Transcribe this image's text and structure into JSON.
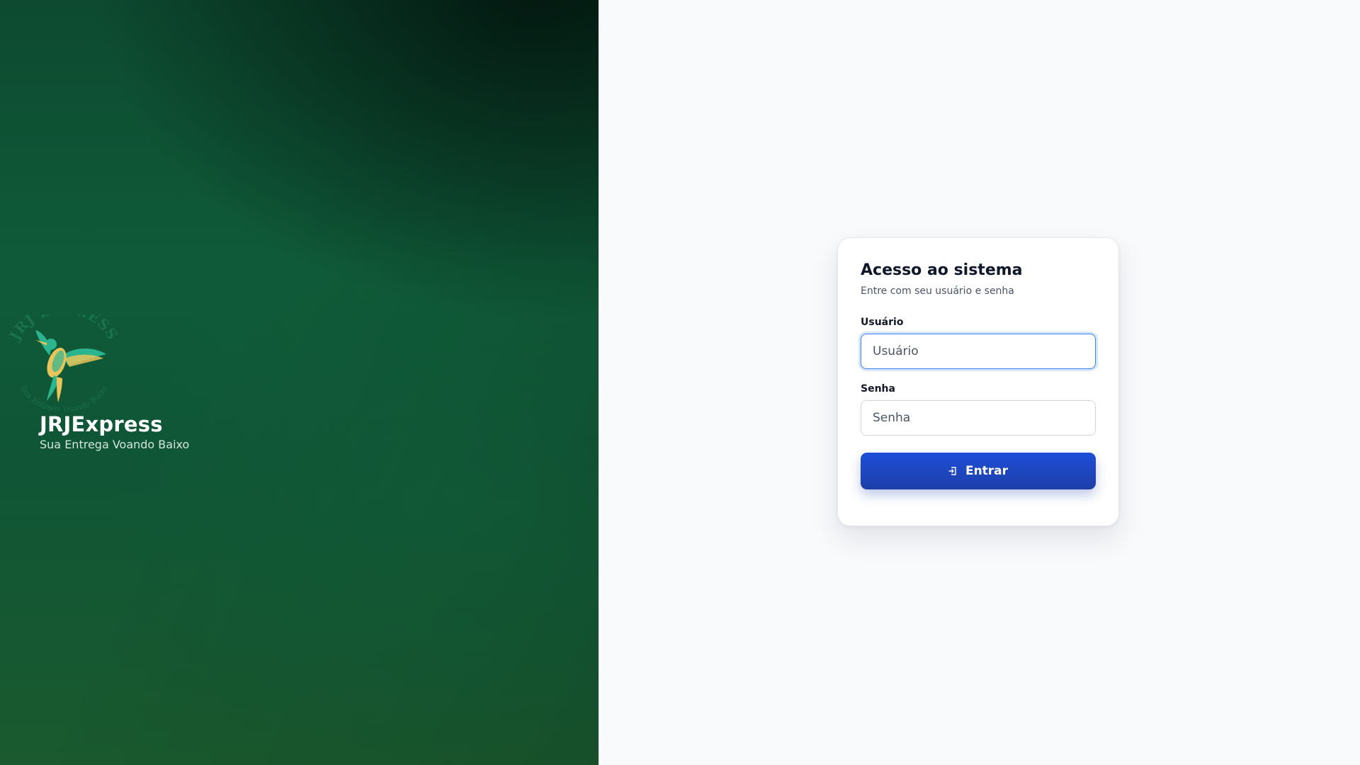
{
  "brand": {
    "name": "JRJExpress",
    "tagline": "Sua Entrega Voando Baixo",
    "logo_icon": "hummingbird-logo-icon",
    "colors": {
      "hero_dark": "#02140e",
      "hero_green": "#0f5b39",
      "logo_teal": "#2bb58f",
      "logo_gold": "#e8c45a"
    }
  },
  "login": {
    "title": "Acesso ao sistema",
    "subtitle": "Entre com seu usuário e senha",
    "username": {
      "label": "Usuário",
      "placeholder": "Usuário",
      "value": ""
    },
    "password": {
      "label": "Senha",
      "placeholder": "Senha",
      "value": ""
    },
    "submit": {
      "label": "Entrar",
      "icon": "sign-in-icon"
    },
    "colors": {
      "accent": "#1d4ed8",
      "focus": "#3b82f6",
      "background": "#f8fafc"
    }
  }
}
